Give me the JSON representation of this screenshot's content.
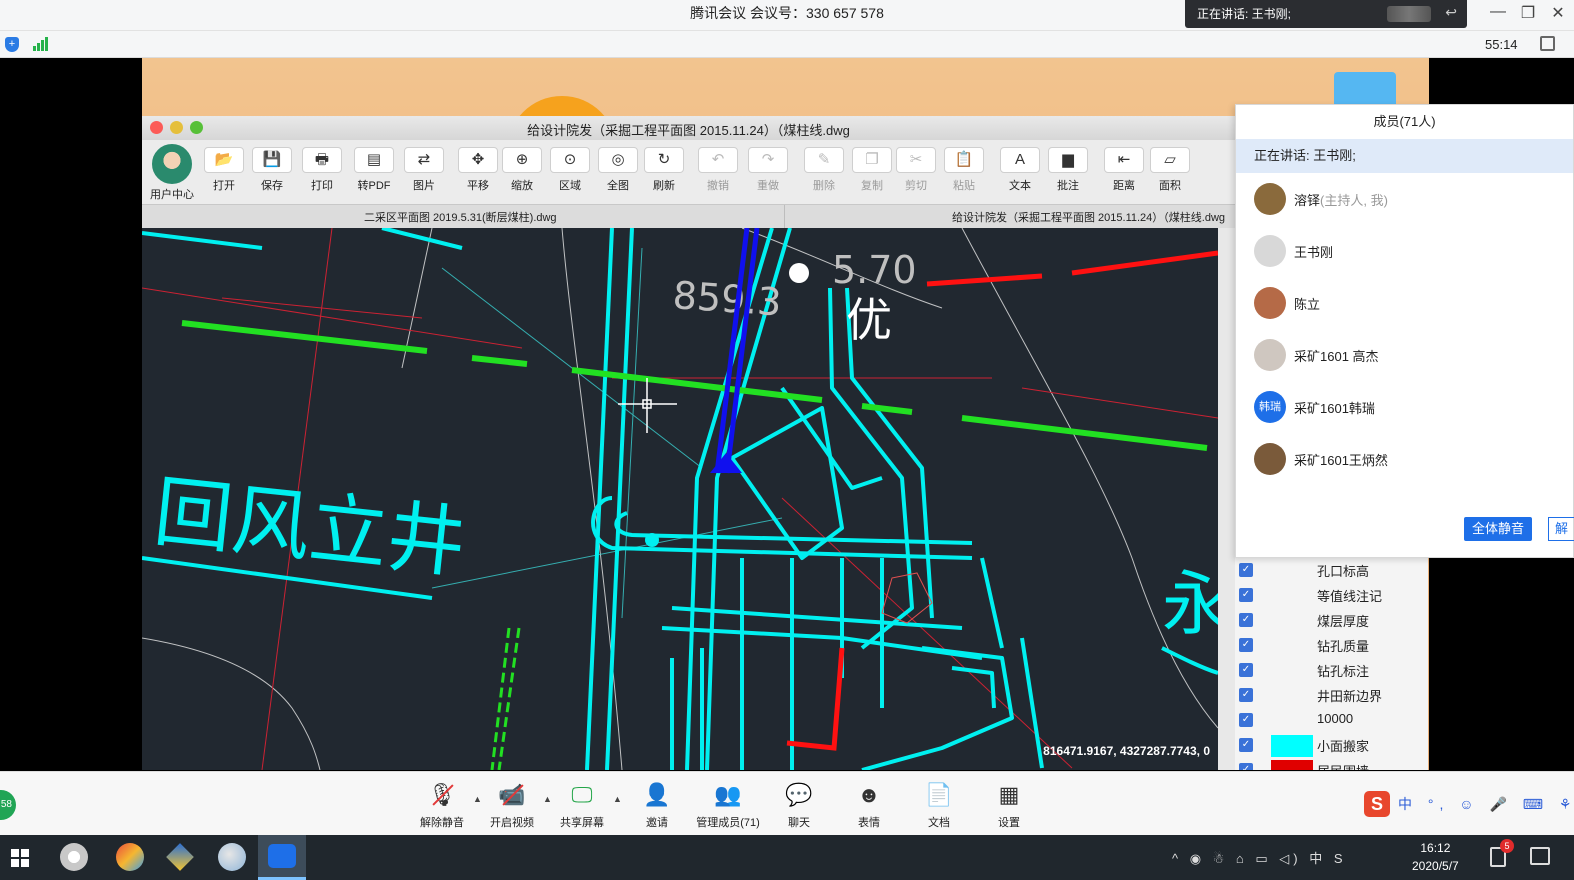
{
  "meeting": {
    "title": "腾讯会议 会议号：330 657 578",
    "speaking_now": "正在讲话: 王书刚;",
    "timer": "55:14"
  },
  "cad": {
    "window_title": "给设计院发（采掘工程平面图 2015.11.24）（煤柱线.dwg",
    "toolbar": [
      {
        "label": "用户中心",
        "icon": "user-avatar",
        "enabled": true
      },
      {
        "label": "打开",
        "icon": "folder-open-icon",
        "glyph": "📂",
        "enabled": true
      },
      {
        "label": "保存",
        "icon": "save-icon",
        "glyph": "💾",
        "enabled": true
      },
      {
        "label": "打印",
        "icon": "print-icon",
        "glyph": "🖶",
        "enabled": true
      },
      {
        "label": "转PDF",
        "icon": "pdf-icon",
        "glyph": "▤",
        "enabled": true
      },
      {
        "label": "图片",
        "icon": "image-icon",
        "glyph": "⇄",
        "enabled": true
      },
      {
        "label": "平移",
        "icon": "pan-icon",
        "glyph": "✥",
        "enabled": true
      },
      {
        "label": "缩放",
        "icon": "zoom-icon",
        "glyph": "⊕",
        "enabled": true
      },
      {
        "label": "区域",
        "icon": "zoom-area-icon",
        "glyph": "⊙",
        "enabled": true
      },
      {
        "label": "全图",
        "icon": "zoom-extents-icon",
        "glyph": "◎",
        "enabled": true
      },
      {
        "label": "刷新",
        "icon": "refresh-icon",
        "glyph": "↻",
        "enabled": true
      },
      {
        "label": "撤销",
        "icon": "undo-icon",
        "glyph": "↶",
        "enabled": false
      },
      {
        "label": "重做",
        "icon": "redo-icon",
        "glyph": "↷",
        "enabled": false
      },
      {
        "label": "删除",
        "icon": "eraser-icon",
        "glyph": "✎",
        "enabled": false
      },
      {
        "label": "复制",
        "icon": "copy-icon",
        "glyph": "❐",
        "enabled": false
      },
      {
        "label": "剪切",
        "icon": "scissors-icon",
        "glyph": "✂",
        "enabled": false
      },
      {
        "label": "粘贴",
        "icon": "paste-icon",
        "glyph": "📋",
        "enabled": false
      },
      {
        "label": "文本",
        "icon": "text-icon",
        "glyph": "A",
        "enabled": true
      },
      {
        "label": "批注",
        "icon": "note-icon",
        "glyph": "▆",
        "enabled": true
      },
      {
        "label": "距离",
        "icon": "distance-icon",
        "glyph": "⇤",
        "enabled": true
      },
      {
        "label": "面积",
        "icon": "area-icon",
        "glyph": "▱",
        "enabled": true
      }
    ],
    "tabs": [
      "二采区平面图 2019.5.31(断层煤柱).dwg",
      "给设计院发（采掘工程平面图 2015.11.24）（煤柱线.dwg"
    ],
    "drawing_labels": {
      "big_text": "回风立井",
      "you": "优",
      "number_top": "5.70",
      "number_left": "859.3",
      "yong": "永"
    },
    "coordinates": "816471.9167, 4327287.7743, 0"
  },
  "layers": [
    {
      "name": "孔口标高",
      "swatch": ""
    },
    {
      "name": "等值线注记",
      "swatch": ""
    },
    {
      "name": "煤层厚度",
      "swatch": ""
    },
    {
      "name": "钻孔质量",
      "swatch": ""
    },
    {
      "name": "钻孔标注",
      "swatch": ""
    },
    {
      "name": "井田新边界",
      "swatch": ""
    },
    {
      "name": "10000",
      "swatch": ""
    },
    {
      "name": "小面搬家",
      "swatch": "#00ffff"
    },
    {
      "name": "居民围墙",
      "swatch": "#e00000"
    }
  ],
  "members": {
    "header": "成员(71人)",
    "speaking": "正在讲话: 王书刚;",
    "list": [
      {
        "name": "溶铎",
        "role": "(主持人, 我)",
        "avatar_color": "#8a6a3c"
      },
      {
        "name": "王书刚",
        "role": "",
        "avatar_color": "#d8d8d8"
      },
      {
        "name": "陈立",
        "role": "",
        "avatar_color": "#b56a47"
      },
      {
        "name": "采矿1601 高杰",
        "role": "",
        "avatar_color": "#cfc7c0"
      },
      {
        "name": "采矿1601韩瑞",
        "role": "",
        "avatar_color": "#1e6fe8",
        "avatar_text": "韩瑞"
      },
      {
        "name": "采矿1601王炳然",
        "role": "",
        "avatar_color": "#7a5a3a"
      }
    ],
    "mute_all": "全体静音",
    "unmute_all_partial": "解"
  },
  "controls": [
    {
      "label": "解除静音",
      "icon": "mic-muted-icon",
      "glyph": "🎙"
    },
    {
      "label": "开启视频",
      "icon": "camera-off-icon",
      "glyph": "📹"
    },
    {
      "label": "共享屏幕",
      "icon": "share-screen-icon",
      "glyph": "🖵"
    },
    {
      "label": "邀请",
      "icon": "invite-icon",
      "glyph": "👤"
    },
    {
      "label": "管理成员(71)",
      "icon": "members-icon",
      "glyph": "👥"
    },
    {
      "label": "聊天",
      "icon": "chat-icon",
      "glyph": "💬"
    },
    {
      "label": "表情",
      "icon": "emoji-icon",
      "glyph": "☻"
    },
    {
      "label": "文档",
      "icon": "document-icon",
      "glyph": "📄"
    },
    {
      "label": "设置",
      "icon": "settings-icon",
      "glyph": "▦"
    }
  ],
  "green_badge": "58",
  "ime": {
    "text": "中 °, ☺ 🎤 ⌨ ⚘ 👕 ▦"
  },
  "taskbar": {
    "time": "16:12",
    "date": "2020/5/7",
    "notification_count": "5",
    "tray_text": "^ ◉ ☃ ⌂ ▭ ◁) 中 S"
  }
}
